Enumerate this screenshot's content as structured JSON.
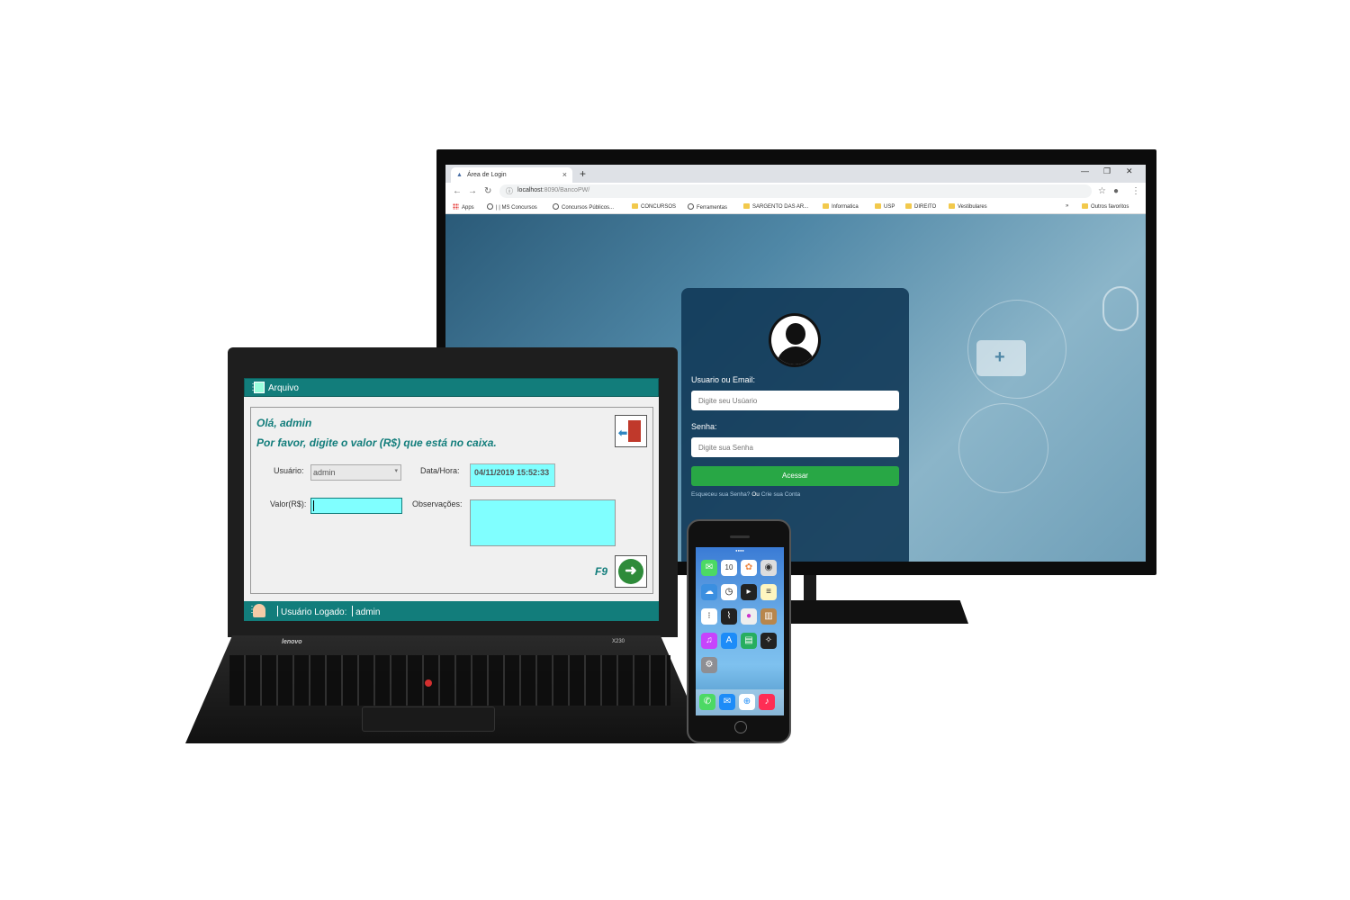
{
  "browser": {
    "tab_title": "Área de Login",
    "url_host": "localhost",
    "url_path": ":8090/BancoPW/",
    "bookmarks": [
      "Apps",
      "| | MS Concursos",
      "Concursos Públicos...",
      "CONCURSOS",
      "Ferramentas",
      "SARGENTO DAS AR...",
      "Informatica",
      "USP",
      "DIREITO",
      "Vestibulares"
    ],
    "more_bookmarks": "»",
    "other_bookmarks": "Outros favoritos"
  },
  "login": {
    "user_label": "Usuario ou Email:",
    "user_placeholder": "Digite seu Usúario",
    "password_label": "Senha:",
    "password_placeholder": "Digite sua Senha",
    "submit_label": "Acessar",
    "forgot_link": "Esqueceu sua Senha?",
    "or_text": "Ou",
    "create_link": "Crie sua Conta"
  },
  "laptop": {
    "brand": "lenovo",
    "model": "X230"
  },
  "desktop_app": {
    "menu_label": "Arquivo",
    "greeting": "Olá,  admin",
    "instruction": "Por favor, digite o valor (R$) que está no caixa.",
    "user_label": "Usuário:",
    "user_value": "admin",
    "datetime_label": "Data/Hora:",
    "datetime_value": "04/11/2019  15:52:33",
    "valor_label": "Valor(R$):",
    "obs_label": "Observações:",
    "shortcut": "F9",
    "status_logged_label": "Usuário Logado:",
    "status_user": "admin",
    "accent_color": "#127d7b",
    "field_color": "#80ffff"
  },
  "phone": {
    "app_icons": [
      "messages-icon",
      "calendar-icon",
      "photos-icon",
      "camera-icon",
      "weather-icon",
      "clock-icon",
      "videos-icon",
      "notes-icon",
      "reminders-icon",
      "stocks-icon",
      "gamecenter-icon",
      "newsstand-icon",
      "itunes-icon",
      "appstore-icon",
      "passbook-icon",
      "compass-icon",
      "settings-icon"
    ],
    "dock_icons": [
      "phone-icon",
      "mail-icon",
      "safari-icon",
      "music-icon"
    ],
    "calendar_day": "10"
  }
}
